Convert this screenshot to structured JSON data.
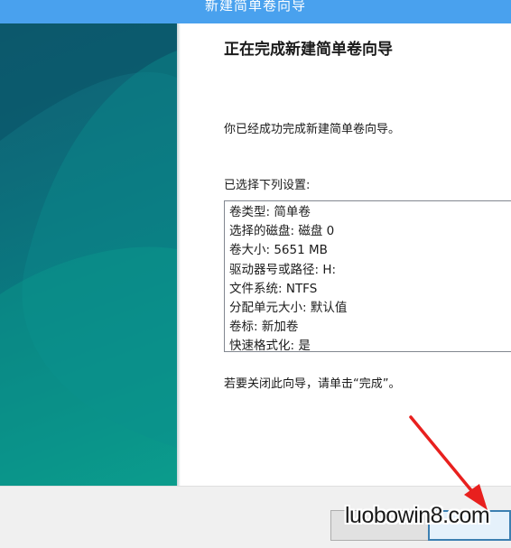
{
  "window": {
    "title": "新建简单卷向导"
  },
  "wizard": {
    "heading": "正在完成新建简单卷向导",
    "intro": "你已经成功完成新建简单卷向导。",
    "settings_label": "已选择下列设置:",
    "settings": [
      "卷类型: 简单卷",
      "选择的磁盘: 磁盘 0",
      "卷大小: 5651 MB",
      "驱动器号或路径: H:",
      "文件系统: NTFS",
      "分配单元大小: 默认值",
      "卷标: 新加卷",
      "快速格式化: 是"
    ],
    "close_hint": "若要关闭此向导，请单击“完成”。"
  },
  "footer": {
    "watermark": "luobowin8.com"
  },
  "colors": {
    "titlebar": "#49a1ee",
    "sidebar": "#0a7a80",
    "arrow": "#e8201e"
  }
}
